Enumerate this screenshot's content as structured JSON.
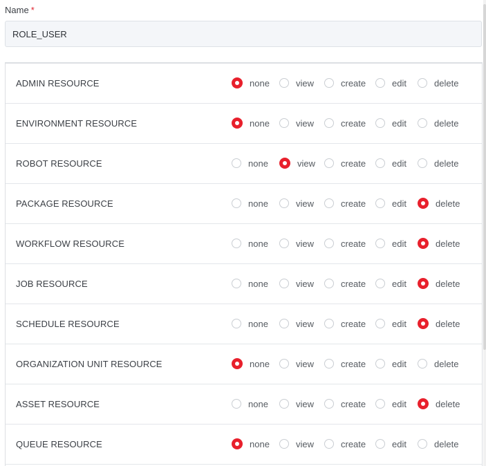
{
  "form": {
    "name_label": "Name",
    "required_mark": "*",
    "name_value": "ROLE_USER"
  },
  "permission_options": [
    "none",
    "view",
    "create",
    "edit",
    "delete"
  ],
  "resources": [
    {
      "label": "ADMIN RESOURCE",
      "selected": "none"
    },
    {
      "label": "ENVIRONMENT RESOURCE",
      "selected": "none"
    },
    {
      "label": "ROBOT RESOURCE",
      "selected": "view"
    },
    {
      "label": "PACKAGE RESOURCE",
      "selected": "delete"
    },
    {
      "label": "WORKFLOW RESOURCE",
      "selected": "delete"
    },
    {
      "label": "JOB RESOURCE",
      "selected": "delete"
    },
    {
      "label": "SCHEDULE RESOURCE",
      "selected": "delete"
    },
    {
      "label": "ORGANIZATION UNIT RESOURCE",
      "selected": "none"
    },
    {
      "label": "ASSET RESOURCE",
      "selected": "delete"
    },
    {
      "label": "QUEUE RESOURCE",
      "selected": "none"
    }
  ],
  "colors": {
    "accent": "#e8202c",
    "input_bg": "#f4f6f9",
    "border": "#dcdfe3"
  }
}
